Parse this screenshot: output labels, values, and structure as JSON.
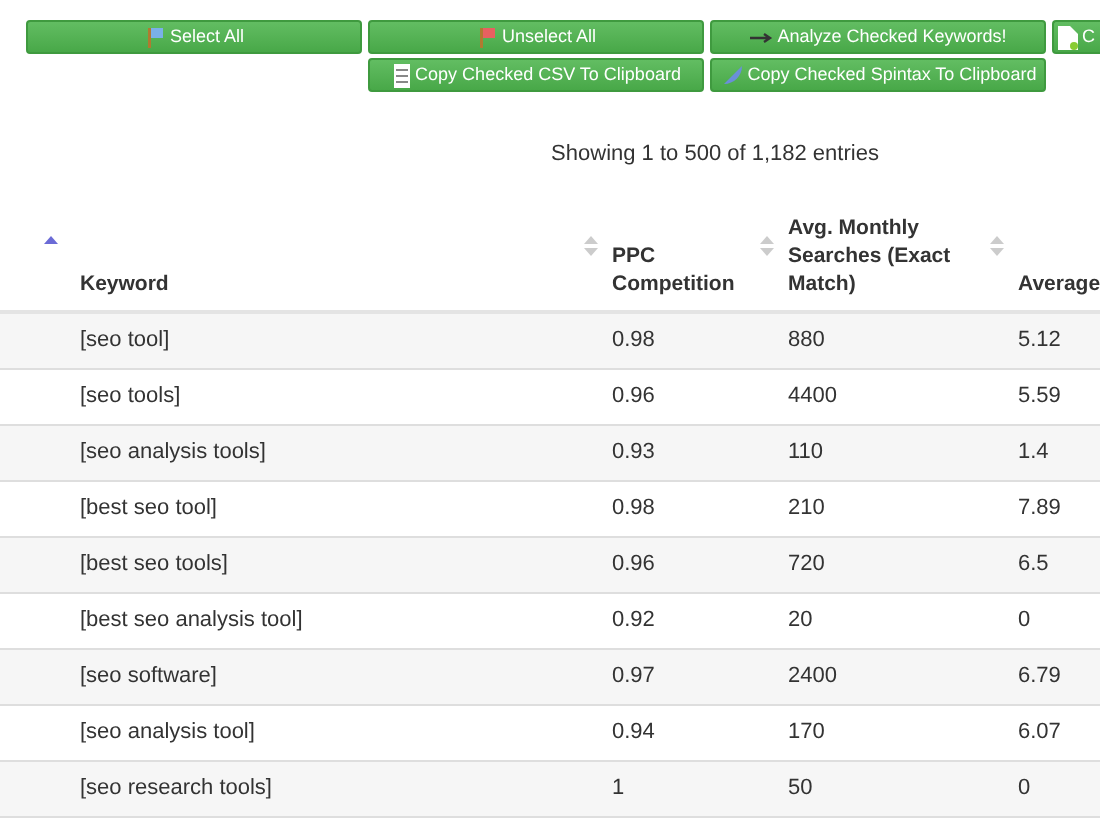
{
  "toolbar_buttons": [
    {
      "label": "Select All"
    },
    {
      "label": "Unselect All"
    },
    {
      "label": "Analyze Checked Keywords!"
    },
    {
      "label": "C"
    }
  ],
  "copy_buttons": [
    {
      "label": "Copy Checked CSV To Clipboard"
    },
    {
      "label": "Copy Checked Spintax To Clipboard"
    }
  ],
  "info": "Showing 1 to 500 of 1,182 entries",
  "table": {
    "columns": [
      {
        "label": "Keyword",
        "sorted": true
      },
      {
        "label": "PPC Competition",
        "sorted": false
      },
      {
        "label": "Avg. Monthly Searches (Exact Match)",
        "sorted": false
      },
      {
        "label": "Average",
        "sorted": false
      }
    ],
    "rows": [
      [
        "[seo tool]",
        "0.98",
        "880",
        "5.12"
      ],
      [
        "[seo tools]",
        "0.96",
        "4400",
        "5.59"
      ],
      [
        "[seo analysis tools]",
        "0.93",
        "110",
        "1.4"
      ],
      [
        "[best seo tool]",
        "0.98",
        "210",
        "7.89"
      ],
      [
        "[best seo tools]",
        "0.96",
        "720",
        "6.5"
      ],
      [
        "[best seo analysis tool]",
        "0.92",
        "20",
        "0"
      ],
      [
        "[seo software]",
        "0.97",
        "2400",
        "6.79"
      ],
      [
        "[seo analysis tool]",
        "0.94",
        "170",
        "6.07"
      ],
      [
        "[seo research tools]",
        "1",
        "50",
        "0"
      ]
    ]
  }
}
